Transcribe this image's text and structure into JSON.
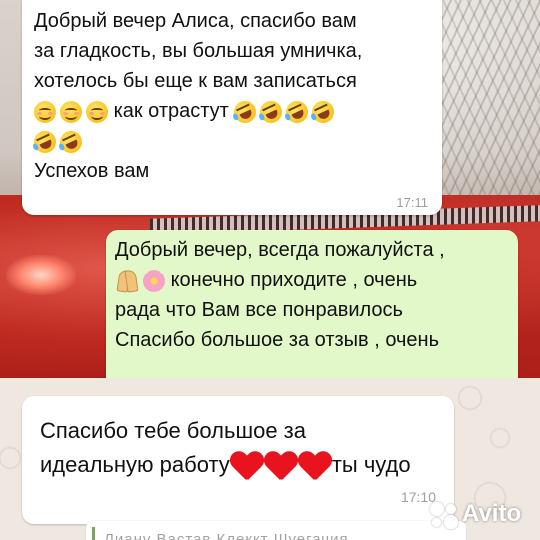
{
  "top_screenshot": {
    "incoming_message": {
      "lines": [
        "Добрый вечер Алиса, спасибо вам",
        "за гладкость, вы большая умничка,",
        "хотелось бы еще к вам записаться"
      ],
      "emoji_line_text": "как отрастут",
      "last_line": "Успехов вам",
      "time": "17:11",
      "emojis_before": [
        "smiling-face-icon",
        "smiling-face-icon",
        "smiling-face-icon"
      ],
      "emojis_after": [
        "rofl-face-icon",
        "rofl-face-icon",
        "rofl-face-icon",
        "rofl-face-icon",
        "rofl-face-icon",
        "rofl-face-icon"
      ]
    },
    "outgoing_message": {
      "lines": [
        "Добрый вечер, всегда пожалуйста ,",
        "конечно приходите , очень",
        "рада что Вам все понравилось",
        "Спасибо большое за отзыв , очень"
      ],
      "emojis": [
        "folded-hands-icon",
        "cherry-blossom-icon"
      ]
    }
  },
  "bottom_screenshot": {
    "incoming_message": {
      "line1": "Спасибо тебе большое за",
      "line2_before": "идеальную работу",
      "line2_after": "ты чудо",
      "time": "17:10",
      "emojis": [
        "red-heart-icon",
        "red-heart-icon",
        "red-heart-icon"
      ]
    },
    "reply_preview": "Лиану Вастав Клеккт Шуегачия"
  },
  "watermark": {
    "text": "Avito"
  },
  "colors": {
    "incoming_bubble": "#ffffff",
    "outgoing_bubble": "#e3f8c9",
    "time_text": "#9aa0a6",
    "heart": "#e8131e"
  }
}
